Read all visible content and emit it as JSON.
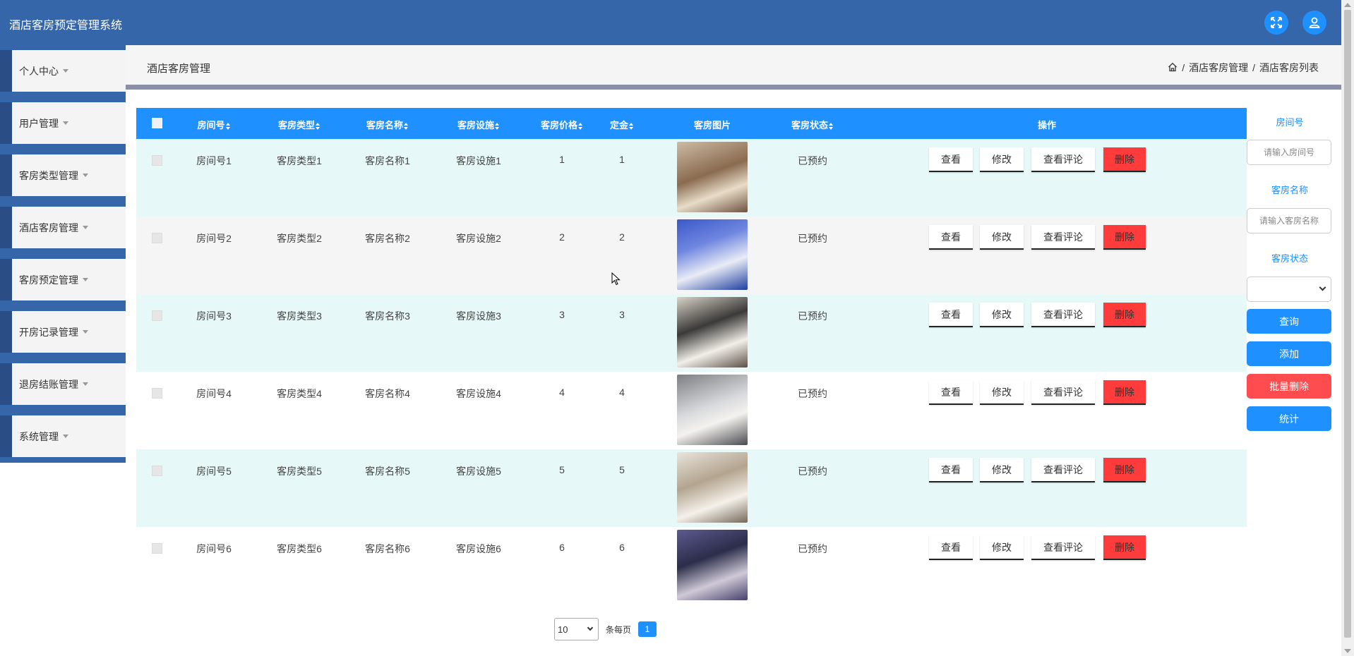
{
  "app": {
    "title": "酒店客房预定管理系统"
  },
  "sidebar": {
    "items": [
      {
        "label": "个人中心"
      },
      {
        "label": "用户管理"
      },
      {
        "label": "客房类型管理"
      },
      {
        "label": "酒店客房管理"
      },
      {
        "label": "客房预定管理"
      },
      {
        "label": "开房记录管理"
      },
      {
        "label": "退房结账管理"
      },
      {
        "label": "系统管理"
      }
    ]
  },
  "page": {
    "title": "酒店客房管理",
    "breadcrumb": [
      "酒店客房管理",
      "酒店客房列表"
    ],
    "breadcrumb_sep": "/"
  },
  "table": {
    "headers": {
      "room_no": "房间号",
      "room_type": "客房类型",
      "room_name": "客房名称",
      "facilities": "客房设施",
      "price": "客房价格",
      "deposit": "定金",
      "image": "客房图片",
      "status": "客房状态",
      "actions": "操作"
    },
    "action_labels": {
      "view": "查看",
      "edit": "修改",
      "review": "查看评论",
      "delete": "删除"
    },
    "rows": [
      {
        "room_no": "房间号1",
        "room_type": "客房类型1",
        "room_name": "客房名称1",
        "facilities": "客房设施1",
        "price": "1",
        "deposit": "1",
        "status": "已预约"
      },
      {
        "room_no": "房间号2",
        "room_type": "客房类型2",
        "room_name": "客房名称2",
        "facilities": "客房设施2",
        "price": "2",
        "deposit": "2",
        "status": "已预约"
      },
      {
        "room_no": "房间号3",
        "room_type": "客房类型3",
        "room_name": "客房名称3",
        "facilities": "客房设施3",
        "price": "3",
        "deposit": "3",
        "status": "已预约"
      },
      {
        "room_no": "房间号4",
        "room_type": "客房类型4",
        "room_name": "客房名称4",
        "facilities": "客房设施4",
        "price": "4",
        "deposit": "4",
        "status": "已预约"
      },
      {
        "room_no": "房间号5",
        "room_type": "客房类型5",
        "room_name": "客房名称5",
        "facilities": "客房设施5",
        "price": "5",
        "deposit": "5",
        "status": "已预约"
      },
      {
        "room_no": "房间号6",
        "room_type": "客房类型6",
        "room_name": "客房名称6",
        "facilities": "客房设施6",
        "price": "6",
        "deposit": "6",
        "status": "已预约"
      }
    ]
  },
  "filters": {
    "room_no_label": "房间号",
    "room_no_placeholder": "请输入房间号",
    "room_no_value": "",
    "room_name_label": "客房名称",
    "room_name_placeholder": "请输入客房名称",
    "room_name_value": "",
    "status_label": "客房状态",
    "status_value": "",
    "buttons": {
      "search": "查询",
      "add": "添加",
      "batch_delete": "批量删除",
      "stats": "统计"
    }
  },
  "pagination": {
    "page_size": "10",
    "per_page_label": "条每页",
    "current_page": "1"
  },
  "colors": {
    "header": "#3566a9",
    "primary": "#1e90ff",
    "danger": "#ff4d4f",
    "delete_btn": "#ff3b3b",
    "row_alt": "#e6f8f8"
  }
}
